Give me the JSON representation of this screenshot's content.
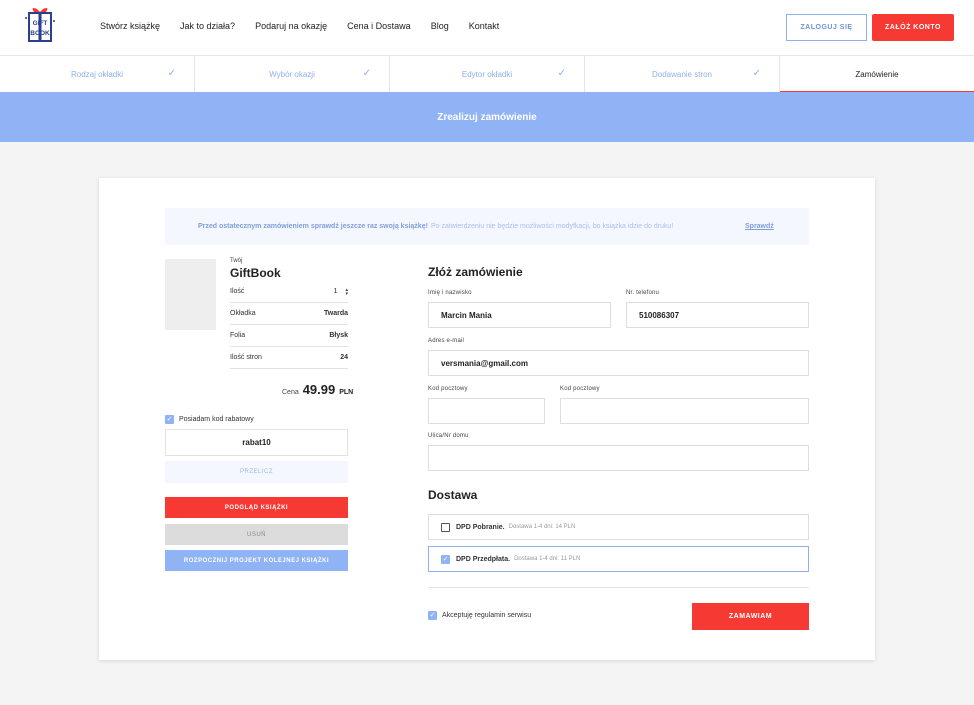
{
  "header": {
    "logo_text": "GIFT BOOK",
    "nav": [
      "Stwórz książkę",
      "Jak to działa?",
      "Podaruj na okazję",
      "Cena i Dostawa",
      "Blog",
      "Kontakt"
    ],
    "login_label": "ZALOGUJ SIĘ",
    "register_label": "ZAŁÓŻ KONTO"
  },
  "steps": [
    "Rodzaj okładki",
    "Wybór okazji",
    "Edytor okładki",
    "Dodawanie stron",
    "Zamówienie"
  ],
  "banner": "Zrealizuj zamówienie",
  "notice": {
    "bold": "Przed ostatecznym zamówieniem sprawdź jeszcze raz swoją książkę!",
    "rest": "Po zatwierdzeniu nie będzie możliwości modyfkacji, bo książka idzie do druku!",
    "link": "Sprawdź"
  },
  "summary": {
    "your": "Twój",
    "title": "GiftBook",
    "rows": [
      {
        "label": "Ilość",
        "value": "1"
      },
      {
        "label": "Okładka",
        "value": "Twarda"
      },
      {
        "label": "Folia",
        "value": "Błysk"
      },
      {
        "label": "Ilość stron",
        "value": "24"
      }
    ],
    "price_label": "Cena",
    "price": "49.99",
    "currency": "PLN",
    "promo_label": "Posiadam kod rabatowy",
    "promo_code": "rabat10",
    "recalc": "PRZELICZ",
    "preview": "PODGLĄD KSIĄŻKI",
    "delete": "USUŃ",
    "new_project": "ROZPOCZNIJ PROJEKT KOLEJNEJ KSIĄŻKI"
  },
  "order": {
    "title": "Złóż zamówienie",
    "name_label": "Imię i nazwisko",
    "name_value": "Marcin Mania",
    "phone_label": "Nr. telefonu",
    "phone_value": "510086307",
    "email_label": "Adres e-mail",
    "email_value": "versmania@gmail.com",
    "postal_label": "Kod pocztowy",
    "city_label": "Kod pocztowy",
    "street_label": "Ulica/Nr domu",
    "shipping_title": "Dostawa",
    "shipping": [
      {
        "name": "DPD Pobranie.",
        "desc": "Dostawa 1-4 dni: 14 PLN",
        "checked": false
      },
      {
        "name": "DPD Przedpłata.",
        "desc": "Dostawa 1-4 dni: 11 PLN",
        "checked": true
      }
    ],
    "terms": "Akceptuję regulamin serwisu",
    "submit": "ZAMAWIAM"
  },
  "colors": {
    "accent": "#f63a33",
    "blue": "#90b3f6"
  }
}
